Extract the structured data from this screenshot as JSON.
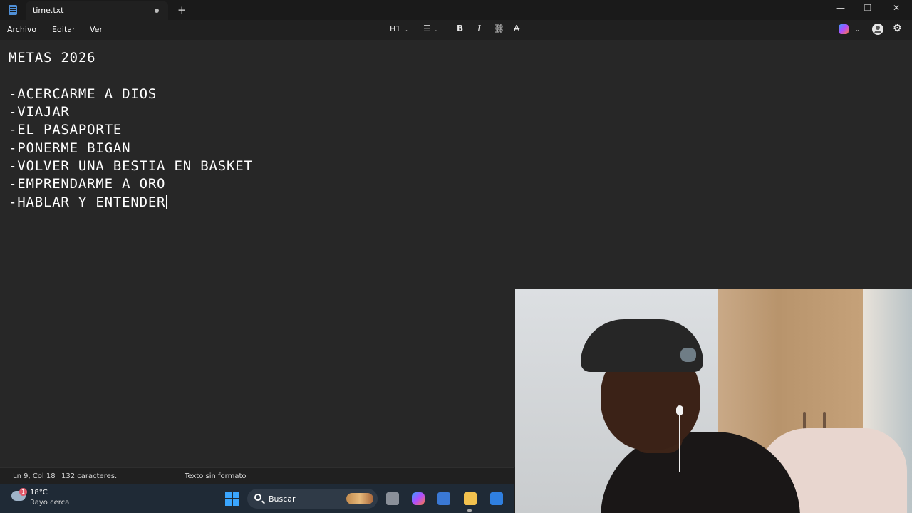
{
  "window": {
    "tab_title": "time.txt",
    "new_tab_symbol": "+",
    "minimize_symbol": "—",
    "maximize_symbol": "❐",
    "close_symbol": "✕"
  },
  "menu": {
    "archivo": "Archivo",
    "editar": "Editar",
    "ver": "Ver"
  },
  "toolbar": {
    "heading": "H1",
    "bold": "B",
    "italic": "I",
    "list_glyph": "☰",
    "link_glyph": "⛓",
    "clear_format_glyph": "A̶",
    "settings_glyph": "⚙"
  },
  "document": {
    "lines": [
      "METAS 2026",
      "",
      "-ACERCARME A DIOS",
      "-VIAJAR",
      "-EL PASAPORTE",
      "-PONERME BIGAN",
      "-VOLVER UNA BESTIA EN BASKET",
      "-EMPRENDARME A ORO",
      "-HABLAR Y ENTENDER"
    ]
  },
  "status": {
    "position": "Ln 9, Col 18",
    "char_count": "132 caracteres.",
    "format": "Texto sin formato"
  },
  "taskbar": {
    "weather_temp": "18°C",
    "weather_desc": "Rayo cerca",
    "weather_badge": "1",
    "search_label": "Buscar"
  },
  "colors": {
    "editor_bg": "#272727",
    "titlebar_bg": "#1a1a1a",
    "taskbar_bg": "#1f2a36",
    "accent": "#3aa6ff"
  }
}
